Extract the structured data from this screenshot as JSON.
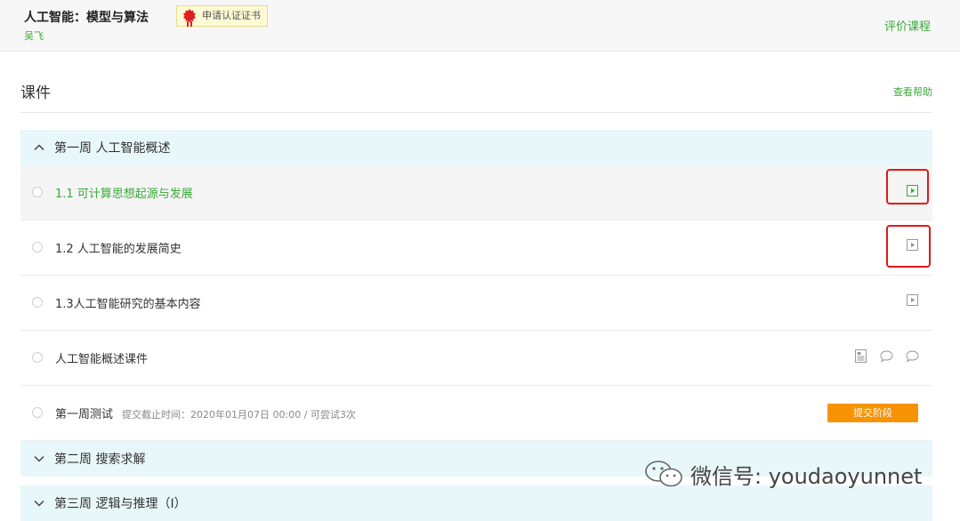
{
  "header": {
    "course_title": "人工智能：模型与算法",
    "teacher": "吴飞",
    "cert_label": "申请认证证书",
    "rate_label": "评价课程"
  },
  "courseware": {
    "title": "课件",
    "help_label": "查看帮助"
  },
  "weeks": [
    {
      "label": "第一周 人工智能概述",
      "expanded": true,
      "lessons": [
        {
          "label": "1.1 可计算思想起源与发展",
          "type": "video",
          "active": true
        },
        {
          "label": "1.2 人工智能的发展简史",
          "type": "video",
          "active": false
        },
        {
          "label": "1.3人工智能研究的基本内容",
          "type": "video",
          "active": false
        },
        {
          "label": "人工智能概述课件",
          "type": "document",
          "active": false
        },
        {
          "label": "第一周测试",
          "type": "quiz",
          "meta": "提交截止时间：2020年01月07日 00:00 / 可尝试3次",
          "button": "提交阶段",
          "active": false
        }
      ]
    },
    {
      "label": "第二周 搜索求解",
      "expanded": false
    },
    {
      "label": "第三周 逻辑与推理（I）",
      "expanded": false
    }
  ],
  "watermark": "微信号: youdaoyunnet",
  "colors": {
    "accent_green": "#39a939",
    "week_header_bg": "#e8f7f9",
    "submit_orange": "#f79303",
    "highlight_red": "#e01919"
  }
}
